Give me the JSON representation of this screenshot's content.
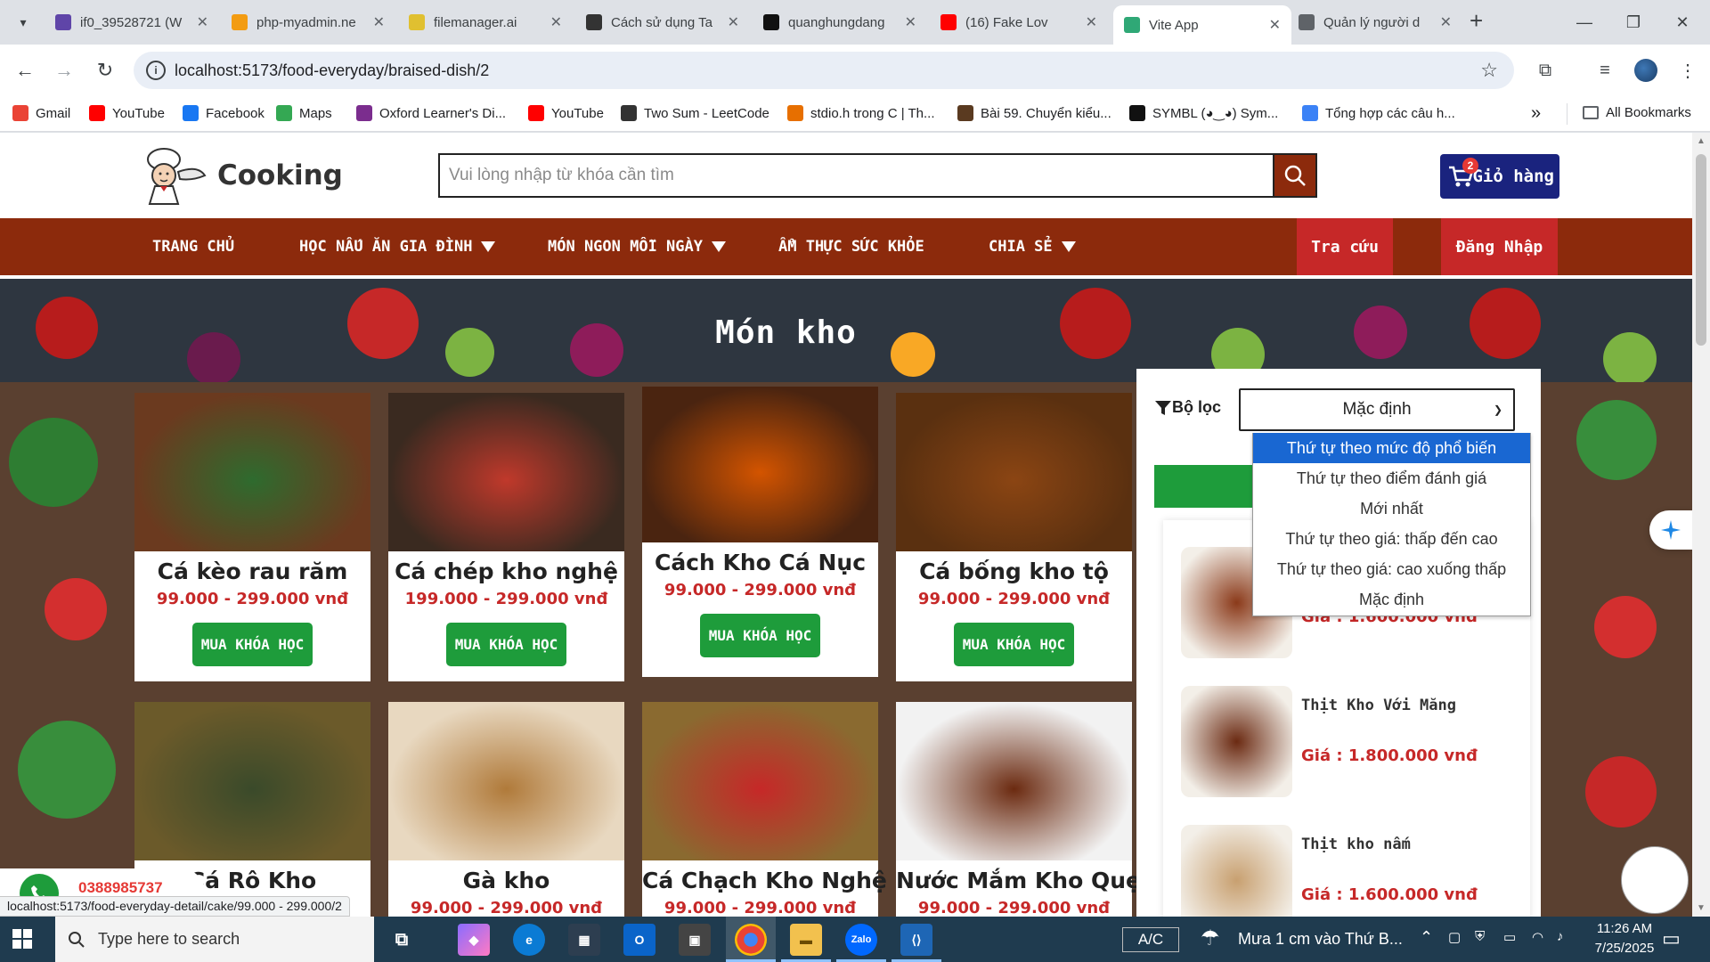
{
  "browser": {
    "tabs": [
      {
        "title": "if0_39528721 (W",
        "icon": "infinity-icon",
        "color": "#5f45a8"
      },
      {
        "title": "php-myadmin.ne",
        "icon": "phpmyadmin-icon",
        "color": "#f39c12"
      },
      {
        "title": "filemanager.ai",
        "icon": "filemanager-icon",
        "color": "#e0c030"
      },
      {
        "title": "Cách sử dụng Ta",
        "icon": "chatgpt-icon",
        "color": "#333333"
      },
      {
        "title": "quanghungdang",
        "icon": "github-icon",
        "color": "#111111"
      },
      {
        "title": "(16) Fake Lov",
        "icon": "youtube-icon",
        "color": "#ff0000"
      },
      {
        "title": "Vite App",
        "icon": "vite-icon",
        "color": "#2fa876"
      },
      {
        "title": "Quản lý người d",
        "icon": "globe-icon",
        "color": "#5f6368"
      }
    ],
    "url": "localhost:5173/food-everyday/braised-dish/2",
    "bookmarks": [
      {
        "label": "Gmail",
        "icon": "gmail-icon",
        "color": "#ea4335"
      },
      {
        "label": "YouTube",
        "icon": "youtube-icon",
        "color": "#ff0000"
      },
      {
        "label": "Facebook",
        "icon": "facebook-icon",
        "color": "#1877f2"
      },
      {
        "label": "Maps",
        "icon": "maps-icon",
        "color": "#34a853"
      },
      {
        "label": "Oxford Learner's Di...",
        "icon": "oxford-icon",
        "color": "#7b2d8e"
      },
      {
        "label": "YouTube",
        "icon": "youtube-icon",
        "color": "#ff0000"
      },
      {
        "label": "Two Sum - LeetCode",
        "icon": "leetcode-icon",
        "color": "#333333"
      },
      {
        "label": "stdio.h trong C | Th...",
        "icon": "java-icon",
        "color": "#e76f00"
      },
      {
        "label": "Bài 59. Chuyển kiểu...",
        "icon": "person-icon",
        "color": "#5a3a20"
      },
      {
        "label": "SYMBL (◕‿◕) Sym...",
        "icon": "symbl-icon",
        "color": "#111111"
      },
      {
        "label": "Tổng hợp các câu h...",
        "icon": "diamond-icon",
        "color": "#3b82f6"
      }
    ],
    "all_bookmarks": "All Bookmarks",
    "overflow": "»"
  },
  "site": {
    "brand": "Cooking",
    "search_placeholder": "Vui lòng nhập từ khóa cần tìm",
    "cart_label": "Giỏ hàng",
    "cart_count": "2",
    "nav": [
      {
        "label": "TRANG CHỦ",
        "dropdown": false
      },
      {
        "label": "HỌC NẤU ĂN GIA ĐÌNH",
        "dropdown": true
      },
      {
        "label": "MÓN NGON MỖI NGÀY",
        "dropdown": true
      },
      {
        "label": "ẨM THỰC SỨC KHỎE",
        "dropdown": false
      },
      {
        "label": "CHIA SẺ",
        "dropdown": true
      }
    ],
    "lookup_label": "Tra cứu",
    "login_label": "Đăng Nhập",
    "page_title": "Món kho",
    "products": [
      {
        "name": "Cá kèo rau răm",
        "price": "99.000 - 299.000 vnđ",
        "buy": "MUA KHÓA HỌC"
      },
      {
        "name": "Cá chép kho nghệ",
        "price": "199.000 - 299.000 vnđ",
        "buy": "MUA KHÓA HỌC"
      },
      {
        "name": "Cách Kho Cá Nục",
        "price": "99.000 - 299.000 vnđ",
        "buy": "MUA KHÓA HỌC"
      },
      {
        "name": "Cá bống kho tộ",
        "price": "99.000 - 299.000 vnđ",
        "buy": "MUA KHÓA HỌC"
      },
      {
        "name": "Cá Rô Kho",
        "price": "",
        "buy": ""
      },
      {
        "name": "Gà kho",
        "price": "99.000 - 299.000 vnđ",
        "buy": ""
      },
      {
        "name": "Cá Chạch Kho Nghệ",
        "price": "99.000 - 299.000 vnđ",
        "buy": ""
      },
      {
        "name": "Nước Mắm Kho Quẹt",
        "price": "99.000 - 299.000 vnđ",
        "buy": ""
      }
    ],
    "filter": {
      "label": "Bộ lọc",
      "selected": "Mặc định",
      "options": [
        "Thứ tự theo mức độ phổ biến",
        "Thứ tự theo điểm đánh giá",
        "Mới nhất",
        "Thứ tự theo giá: thấp đến cao",
        "Thứ tự theo giá: cao xuống thấp",
        "Mặc định"
      ],
      "highlighted_index": 0
    },
    "sidebar_items": [
      {
        "title": "",
        "price": "Giá : 1.600.000 vnđ"
      },
      {
        "title": "Thịt Kho Với Măng",
        "price": "Giá : 1.800.000 vnđ"
      },
      {
        "title": "Thịt kho nấm",
        "price": "Giá : 1.600.000 vnđ"
      }
    ],
    "phone": "0388985737",
    "status_url": "localhost:5173/food-everyday-detail/cake/99.000 - 299.000/2"
  },
  "taskbar": {
    "search_placeholder": "Type here to search",
    "keyboard": "A/C",
    "weather": "Mưa 1 cm vào Thứ B...",
    "time": "11:26 AM",
    "date": "7/25/2025"
  },
  "colors": {
    "nav_bg": "#8c2a0c",
    "cta_red": "#c62828",
    "buy_green": "#1e9c3b",
    "price_red": "#c62828",
    "cart_blue": "#1a237e",
    "dropdown_highlight": "#1967d2"
  }
}
